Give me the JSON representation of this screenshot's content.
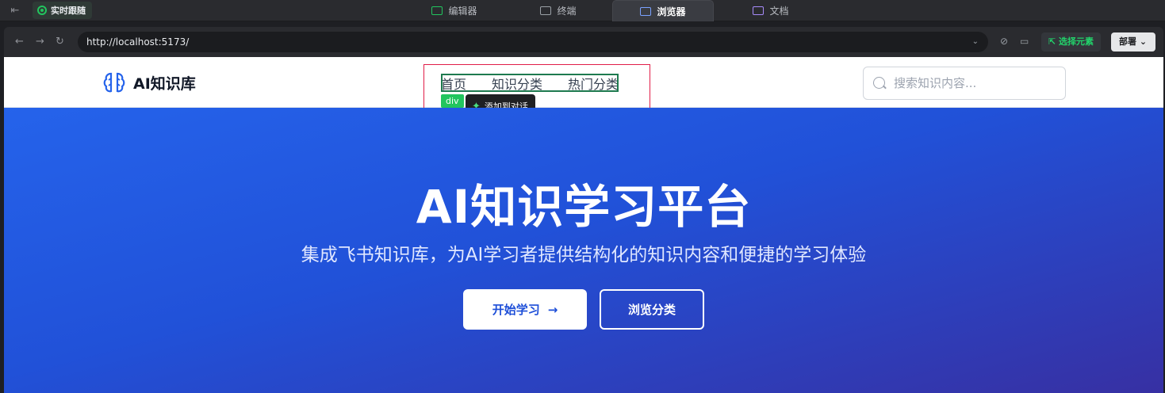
{
  "ide": {
    "follow_label": "实时跟随",
    "tabs": [
      {
        "label": "编辑器",
        "icon": "editor-icon"
      },
      {
        "label": "终端",
        "icon": "terminal-icon"
      },
      {
        "label": "浏览器",
        "icon": "browser-icon",
        "active": true
      },
      {
        "label": "文档",
        "icon": "docs-icon"
      }
    ]
  },
  "browser": {
    "url": "http://localhost:5173/",
    "pick_element_label": "选择元素",
    "deploy_label": "部署"
  },
  "site": {
    "logo_text": "AI知识库",
    "nav": [
      "首页",
      "知识分类",
      "热门分类"
    ],
    "search_placeholder": "搜索知识内容...",
    "hero_title": "AI知识学习平台",
    "hero_subtitle": "集成飞书知识库，为AI学习者提供结构化的知识内容和便捷的学习体验",
    "start_button": "开始学习",
    "browse_button": "浏览分类"
  },
  "inspector": {
    "tag_label": "div",
    "add_to_chat_label": "添加到对话"
  },
  "colors": {
    "accent_green": "#22c55e",
    "hero_blue": "#2563eb",
    "selection_red": "#e11d48"
  }
}
